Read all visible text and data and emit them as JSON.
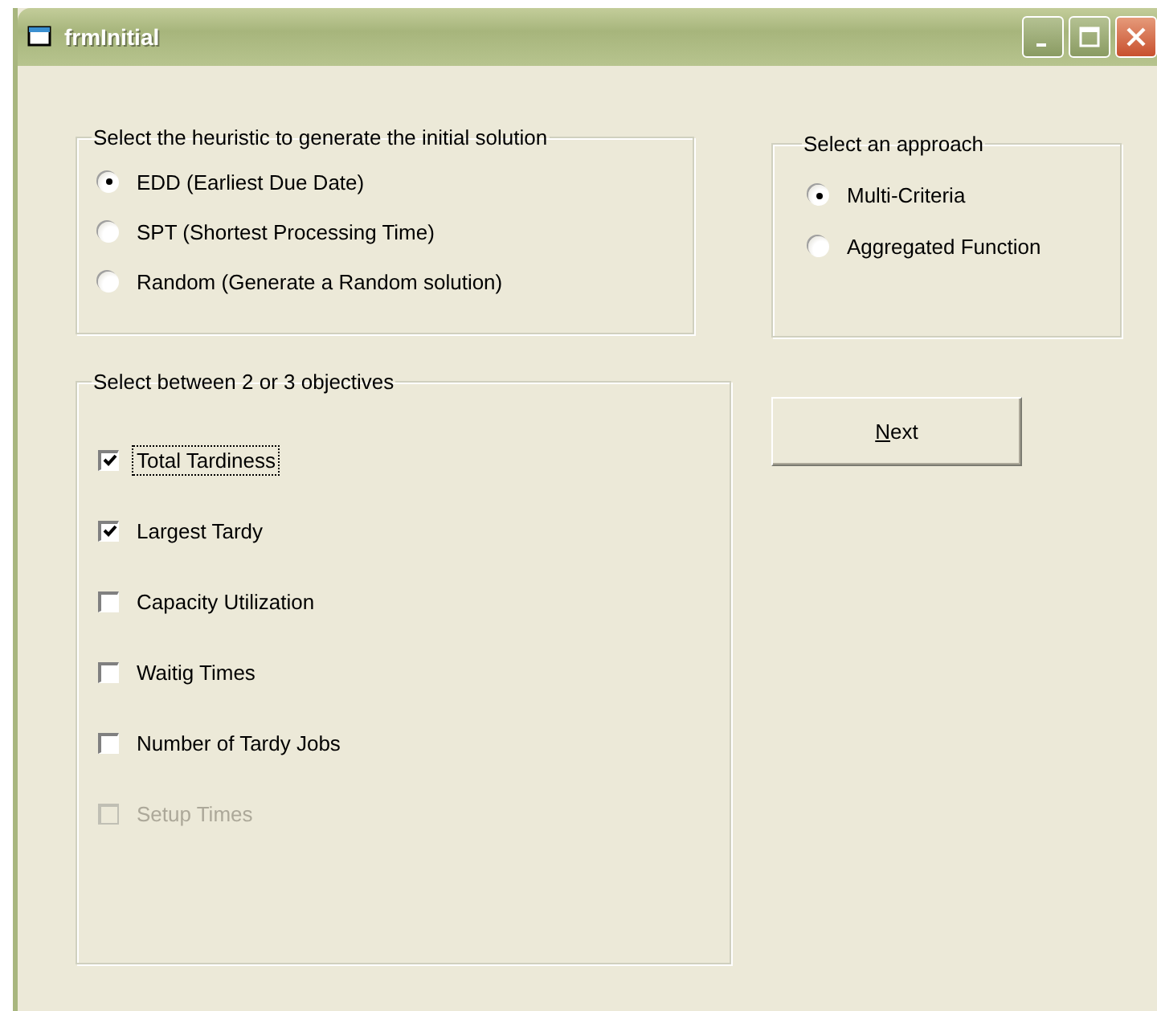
{
  "window": {
    "title": "frmInitial"
  },
  "heuristic_group": {
    "caption": "Select the heuristic to generate the initial solution",
    "options": [
      {
        "label": "EDD (Earliest Due Date)",
        "selected": true
      },
      {
        "label": "SPT (Shortest Processing Time)",
        "selected": false
      },
      {
        "label": "Random (Generate a Random solution)",
        "selected": false
      }
    ]
  },
  "approach_group": {
    "caption": "Select an approach",
    "options": [
      {
        "label": "Multi-Criteria",
        "selected": true
      },
      {
        "label": "Aggregated Function",
        "selected": false
      }
    ]
  },
  "next_button": {
    "label": "Next",
    "access_key_underlined": true
  },
  "objectives_group": {
    "caption": "Select between 2 or 3 objectives",
    "items": [
      {
        "label": "Total Tardiness",
        "checked": true,
        "disabled": false,
        "focused": true
      },
      {
        "label": "Largest Tardy",
        "checked": true,
        "disabled": false,
        "focused": false
      },
      {
        "label": "Capacity Utilization",
        "checked": false,
        "disabled": false,
        "focused": false
      },
      {
        "label": "Waitig Times",
        "checked": false,
        "disabled": false,
        "focused": false
      },
      {
        "label": "Number of Tardy Jobs",
        "checked": false,
        "disabled": false,
        "focused": false
      },
      {
        "label": "Setup Times",
        "checked": false,
        "disabled": true,
        "focused": false
      }
    ]
  }
}
